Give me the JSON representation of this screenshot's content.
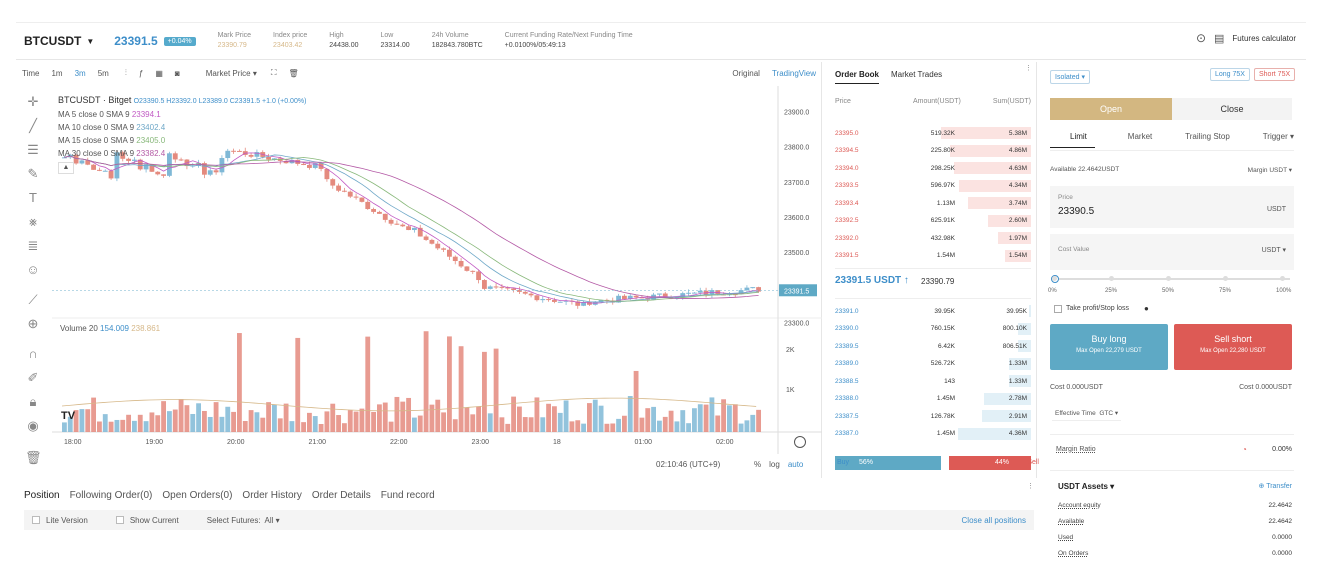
{
  "header": {
    "symbol": "BTCUSDT",
    "last_price": "23391.5",
    "change_pct": "+0.04%",
    "stats": [
      {
        "label": "Mark Price",
        "value": "23390.79",
        "style": "y"
      },
      {
        "label": "Index price",
        "value": "23403.42",
        "style": "y"
      },
      {
        "label": "High",
        "value": "24438.00",
        "style": ""
      },
      {
        "label": "Low",
        "value": "23314.00",
        "style": ""
      },
      {
        "label": "24h Volume",
        "value": "182843.780BTC",
        "style": ""
      },
      {
        "label": "Current Funding Rate/Next Funding Time",
        "value": "+0.0100%/05:49:13",
        "style": ""
      }
    ],
    "futures_calculator": "Futures calculator"
  },
  "toolbar": {
    "time": "Time",
    "intervals": [
      "1m",
      "3m",
      "5m"
    ],
    "active_interval": "3m",
    "price_type": "Market Price",
    "views": [
      "Original",
      "TradingView"
    ]
  },
  "chart": {
    "pair": "BTCUSDT · Bitget",
    "ohlc": "O23390.5 H23392.0 L23389.0 C23391.5 +1.0 (+0.00%)",
    "ma": [
      {
        "label": "MA 5 close 0 SMA 9",
        "value": "23394.1",
        "color": "#c25bc4"
      },
      {
        "label": "MA 10 close 0 SMA 9",
        "value": "23402.4",
        "color": "#6fa8c8"
      },
      {
        "label": "MA 15 close 0 SMA 9",
        "value": "23405.0",
        "color": "#88b87a"
      },
      {
        "label": "MA 30 close 0 SMA 9",
        "value": "23382.4",
        "color": "#b45aa6"
      }
    ],
    "y_ticks": [
      "23900.0",
      "23800.0",
      "23700.0",
      "23600.0",
      "23500.0",
      "23400.0",
      "23300.0"
    ],
    "current_price_tag": "23391.5",
    "volume_label": "Volume 20",
    "volume_v1": "154.009",
    "volume_v2": "238.861",
    "vol_ticks": [
      "2K",
      "1K"
    ],
    "x_ticks": [
      "18:00",
      "19:00",
      "20:00",
      "21:00",
      "22:00",
      "23:00",
      "18",
      "01:00",
      "02:00"
    ],
    "clock": "02:10:46 (UTC+9)",
    "scale_opts": [
      "%",
      "log",
      "auto"
    ]
  },
  "orderbook": {
    "tabs": [
      "Order Book",
      "Market Trades"
    ],
    "headers": [
      "Price",
      "Amount(USDT)",
      "Sum(USDT)"
    ],
    "asks": [
      [
        "23395.0",
        "519.32K",
        "5.38M",
        1.0
      ],
      [
        "23394.5",
        "225.80K",
        "4.86M",
        0.9
      ],
      [
        "23394.0",
        "298.25K",
        "4.63M",
        0.86
      ],
      [
        "23393.5",
        "596.97K",
        "4.34M",
        0.8
      ],
      [
        "23393.4",
        "1.13M",
        "3.74M",
        0.7
      ],
      [
        "23392.5",
        "625.91K",
        "2.60M",
        0.48
      ],
      [
        "23392.0",
        "432.98K",
        "1.97M",
        0.37
      ],
      [
        "23391.5",
        "1.54M",
        "1.54M",
        0.29
      ]
    ],
    "mid_price": "23391.5 USDT ↑",
    "mid_mark": "23390.79",
    "bids": [
      [
        "23391.0",
        "39.95K",
        "39.95K",
        0.02
      ],
      [
        "23390.0",
        "760.15K",
        "800.10K",
        0.15
      ],
      [
        "23389.5",
        "6.42K",
        "806.51K",
        0.15
      ],
      [
        "23389.0",
        "526.72K",
        "1.33M",
        0.25
      ],
      [
        "23388.5",
        "143",
        "1.33M",
        0.25
      ],
      [
        "23388.0",
        "1.45M",
        "2.78M",
        0.52
      ],
      [
        "23387.5",
        "126.78K",
        "2.91M",
        0.54
      ],
      [
        "23387.0",
        "1.45M",
        "4.36M",
        0.81
      ]
    ],
    "buy_label": "Buy",
    "buy_pct": "56%",
    "sell_pct": "44%",
    "sell_label": "Sell",
    "buy_ratio": 0.56
  },
  "trade": {
    "margin_mode": "Isolated",
    "long_btn": "Long 75X",
    "short_btn": "Short 75X",
    "open": "Open",
    "close": "Close",
    "tabs": [
      "Limit",
      "Market",
      "Trailing Stop",
      "Trigger"
    ],
    "available": "Available 22.4642USDT",
    "margin": "Margin",
    "margin_ccy": "USDT",
    "price_label": "Price",
    "price_value": "23390.5",
    "price_ccy": "USDT",
    "cost_label": "Cost Value",
    "cost_ccy": "USDT",
    "slider_marks": [
      "0%",
      "25%",
      "50%",
      "75%",
      "100%"
    ],
    "tpsl": "Take profit/Stop loss",
    "buy_long": "Buy long",
    "buy_sub": "Max Open 22,279 USDT",
    "sell_short": "Sell short",
    "sell_sub": "Max Open 22,280 USDT",
    "cost_left": "Cost 0.000USDT",
    "cost_right": "Cost 0.000USDT",
    "eff_time": "Effective Time",
    "eff_val": "GTC",
    "margin_ratio": "Margin Ratio",
    "margin_ratio_val": "0.00%",
    "assets_title": "USDT Assets",
    "transfer": "Transfer",
    "assets": [
      [
        "Account equity",
        "22.4642"
      ],
      [
        "Available",
        "22.4642"
      ],
      [
        "Used",
        "0.0000"
      ],
      [
        "On Orders",
        "0.0000"
      ]
    ]
  },
  "bottom": {
    "tabs": [
      "Position",
      "Following Order(0)",
      "Open Orders(0)",
      "Order History",
      "Order Details",
      "Fund record"
    ],
    "lite": "Lite Version",
    "show_current": "Show Current",
    "select_label": "Select Futures:",
    "select_val": "All",
    "close_all": "Close all positions"
  },
  "colors": {
    "up": "#7fb8d6",
    "down": "#e48a7e",
    "accent": "#3d8ec9",
    "gold": "#d6b889",
    "red": "#dd5a55"
  }
}
